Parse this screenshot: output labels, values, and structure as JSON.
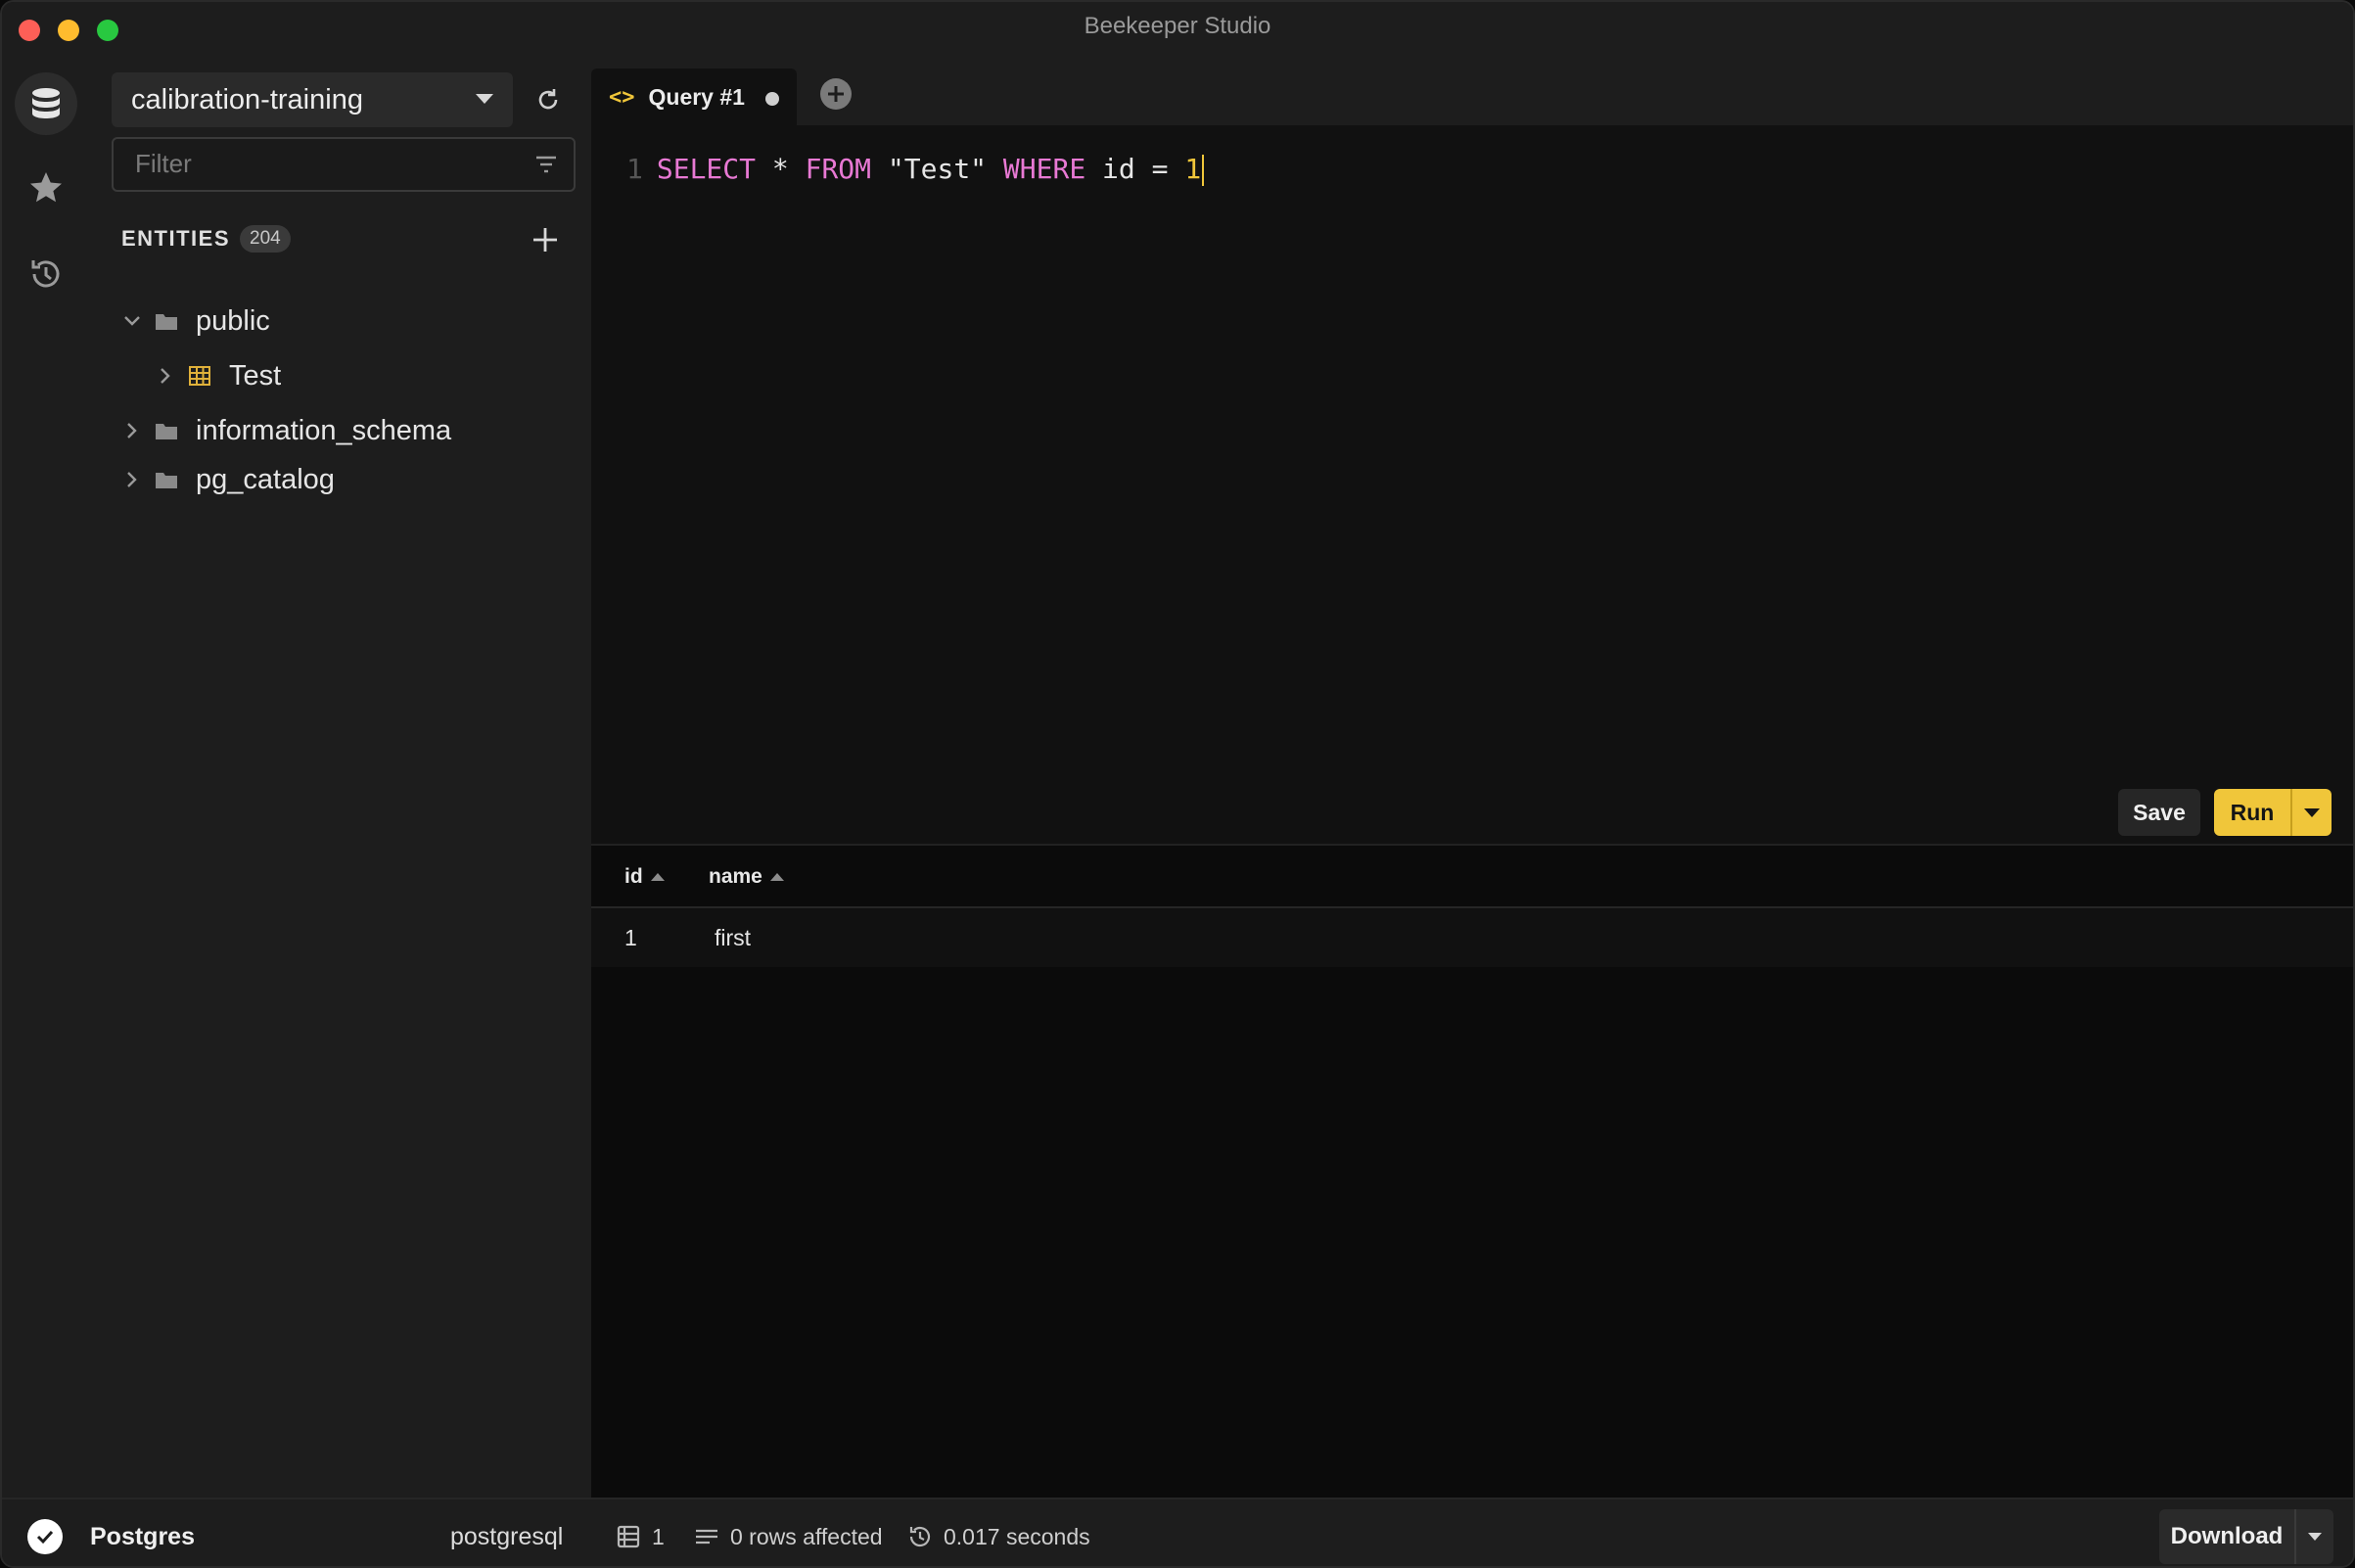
{
  "window": {
    "title": "Beekeeper Studio"
  },
  "sidebar": {
    "connection": "calibration-training",
    "filter_placeholder": "Filter",
    "entities_title": "ENTITIES",
    "entities_count": "204",
    "tree": [
      {
        "label": "public",
        "kind": "schema",
        "expanded": true
      },
      {
        "label": "Test",
        "kind": "table",
        "expanded": false
      },
      {
        "label": "information_schema",
        "kind": "schema",
        "expanded": false
      },
      {
        "label": "pg_catalog",
        "kind": "schema",
        "expanded": false
      }
    ]
  },
  "tabs": [
    {
      "label": "Query #1",
      "icon": "code-icon",
      "unsaved": true
    }
  ],
  "editor": {
    "line_number": "1",
    "tokens": {
      "select": "SELECT",
      "star": " * ",
      "from": "FROM",
      "table": " \"Test\" ",
      "where": "WHERE",
      "cond": " id = ",
      "value": "1"
    },
    "save_label": "Save",
    "run_label": "Run"
  },
  "results": {
    "columns": [
      "id",
      "name"
    ],
    "rows": [
      [
        "1",
        "first"
      ]
    ]
  },
  "status": {
    "connection_name": "Postgres",
    "connection_type": "postgresql",
    "row_count": "1",
    "affected": "0 rows affected",
    "duration": "0.017 seconds",
    "download_label": "Download"
  },
  "colors": {
    "accent": "#f0c63a",
    "keyword": "#e879d4",
    "background": "#111111"
  }
}
